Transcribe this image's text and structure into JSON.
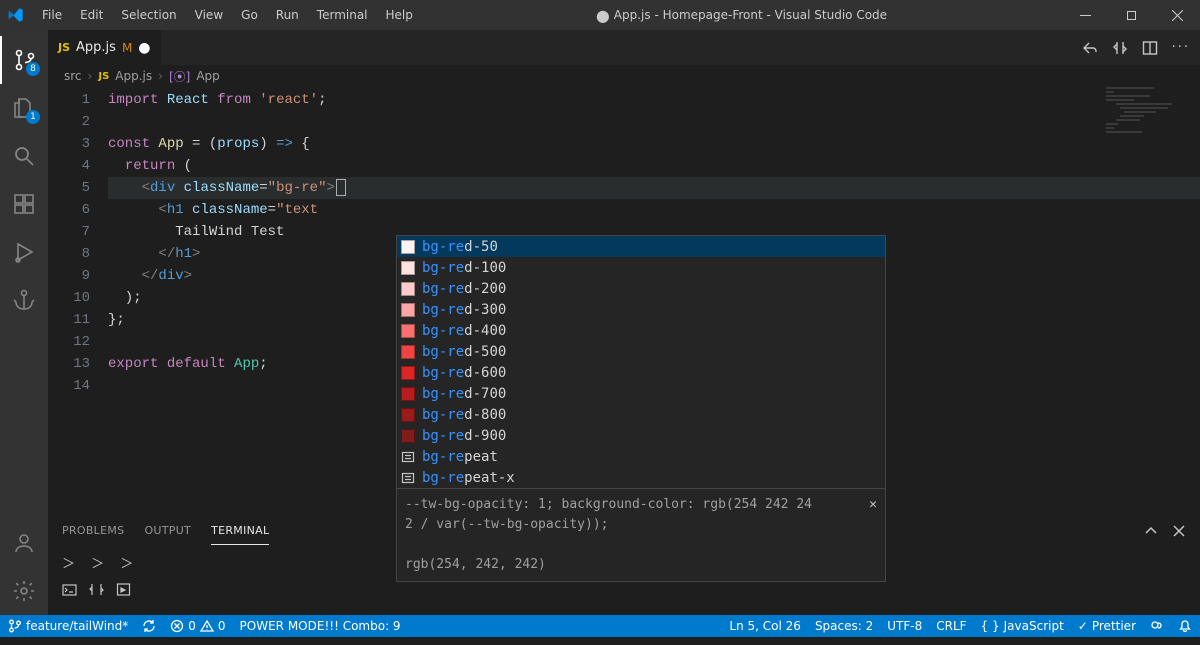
{
  "menu": [
    "File",
    "Edit",
    "Selection",
    "View",
    "Go",
    "Run",
    "Terminal",
    "Help"
  ],
  "title": "App.js - Homepage-Front - Visual Studio Code",
  "title_modified": true,
  "activity_badges": {
    "source_control": "8",
    "explorer": "1"
  },
  "tab": {
    "icon": "JS",
    "name": "App.js",
    "status": "M"
  },
  "breadcrumbs": {
    "folder": "src",
    "file_icon": "JS",
    "file": "App.js",
    "symbol_icon": "⦿",
    "symbol": "App"
  },
  "code": {
    "lines": [
      {
        "n": 1,
        "segs": [
          [
            "kw",
            "import"
          ],
          [
            "op",
            " "
          ],
          [
            "var",
            "React"
          ],
          [
            "op",
            " "
          ],
          [
            "kw",
            "from"
          ],
          [
            "op",
            " "
          ],
          [
            "str",
            "'react'"
          ],
          [
            "op",
            ";"
          ]
        ]
      },
      {
        "n": 2,
        "segs": []
      },
      {
        "n": 3,
        "segs": [
          [
            "kw",
            "const"
          ],
          [
            "op",
            " "
          ],
          [
            "fn",
            "App"
          ],
          [
            "op",
            " "
          ],
          [
            "op",
            "="
          ],
          [
            "op",
            " ("
          ],
          [
            "var",
            "props"
          ],
          [
            "op",
            ") "
          ],
          [
            "ent",
            "=>"
          ],
          [
            "op",
            " {"
          ]
        ]
      },
      {
        "n": 4,
        "segs": [
          [
            "op",
            "  "
          ],
          [
            "kw",
            "return"
          ],
          [
            "op",
            " ("
          ]
        ]
      },
      {
        "n": 5,
        "current": true,
        "cursor": true,
        "segs": [
          [
            "op",
            "    "
          ],
          [
            "tag",
            "<"
          ],
          [
            "ent",
            "div"
          ],
          [
            "op",
            " "
          ],
          [
            "attr",
            "className"
          ],
          [
            "op",
            "="
          ],
          [
            "str",
            "\"bg-re\""
          ],
          [
            "tag",
            ">"
          ]
        ]
      },
      {
        "n": 6,
        "segs": [
          [
            "op",
            "      "
          ],
          [
            "tag",
            "<"
          ],
          [
            "ent",
            "h1"
          ],
          [
            "op",
            " "
          ],
          [
            "attr",
            "className"
          ],
          [
            "op",
            "="
          ],
          [
            "str",
            "\"text"
          ]
        ]
      },
      {
        "n": 7,
        "segs": [
          [
            "op",
            "        TailWind Test"
          ]
        ]
      },
      {
        "n": 8,
        "segs": [
          [
            "op",
            "      "
          ],
          [
            "tag",
            "</"
          ],
          [
            "ent",
            "h1"
          ],
          [
            "tag",
            ">"
          ]
        ]
      },
      {
        "n": 9,
        "segs": [
          [
            "op",
            "    "
          ],
          [
            "tag",
            "</"
          ],
          [
            "ent",
            "div"
          ],
          [
            "tag",
            ">"
          ]
        ]
      },
      {
        "n": 10,
        "segs": [
          [
            "op",
            "  );"
          ]
        ]
      },
      {
        "n": 11,
        "segs": [
          [
            "op",
            "};"
          ]
        ]
      },
      {
        "n": 12,
        "segs": []
      },
      {
        "n": 13,
        "segs": [
          [
            "kw",
            "export"
          ],
          [
            "op",
            " "
          ],
          [
            "kw",
            "default"
          ],
          [
            "op",
            " "
          ],
          [
            "comp",
            "App"
          ],
          [
            "op",
            ";"
          ]
        ]
      },
      {
        "n": 14,
        "segs": []
      }
    ]
  },
  "suggest": {
    "prefix_len": 5,
    "items": [
      {
        "type": "color",
        "color": "#fef2f2",
        "label": "bg-red-50",
        "selected": true
      },
      {
        "type": "color",
        "color": "#fee2e2",
        "label": "bg-red-100"
      },
      {
        "type": "color",
        "color": "#fecaca",
        "label": "bg-red-200"
      },
      {
        "type": "color",
        "color": "#fca5a5",
        "label": "bg-red-300"
      },
      {
        "type": "color",
        "color": "#f87171",
        "label": "bg-red-400"
      },
      {
        "type": "color",
        "color": "#ef4444",
        "label": "bg-red-500"
      },
      {
        "type": "color",
        "color": "#dc2626",
        "label": "bg-red-600"
      },
      {
        "type": "color",
        "color": "#b91c1c",
        "label": "bg-red-700"
      },
      {
        "type": "color",
        "color": "#991b1b",
        "label": "bg-red-800"
      },
      {
        "type": "color",
        "color": "#7f1d1d",
        "label": "bg-red-900"
      },
      {
        "type": "enum",
        "label": "bg-repeat"
      },
      {
        "type": "enum",
        "label": "bg-repeat-x"
      }
    ],
    "detail_line1": "--tw-bg-opacity: 1; background-color: rgb(254 242 24",
    "detail_line2": "2 / var(--tw-bg-opacity));",
    "detail_line3": "rgb(254, 242, 242)"
  },
  "panel": {
    "tabs": [
      "PROBLEMS",
      "OUTPUT",
      "TERMINAL"
    ],
    "active": 2,
    "prompts": "＞ ＞ ＞"
  },
  "status": {
    "branch": "feature/tailWind*",
    "errors": "0",
    "warnings": "0",
    "power": "POWER MODE!!! Combo: 9",
    "cursor": "Ln 5, Col 26",
    "spaces": "Spaces: 2",
    "encoding": "UTF-8",
    "eol": "CRLF",
    "lang": "JavaScript",
    "prettier": "Prettier"
  }
}
